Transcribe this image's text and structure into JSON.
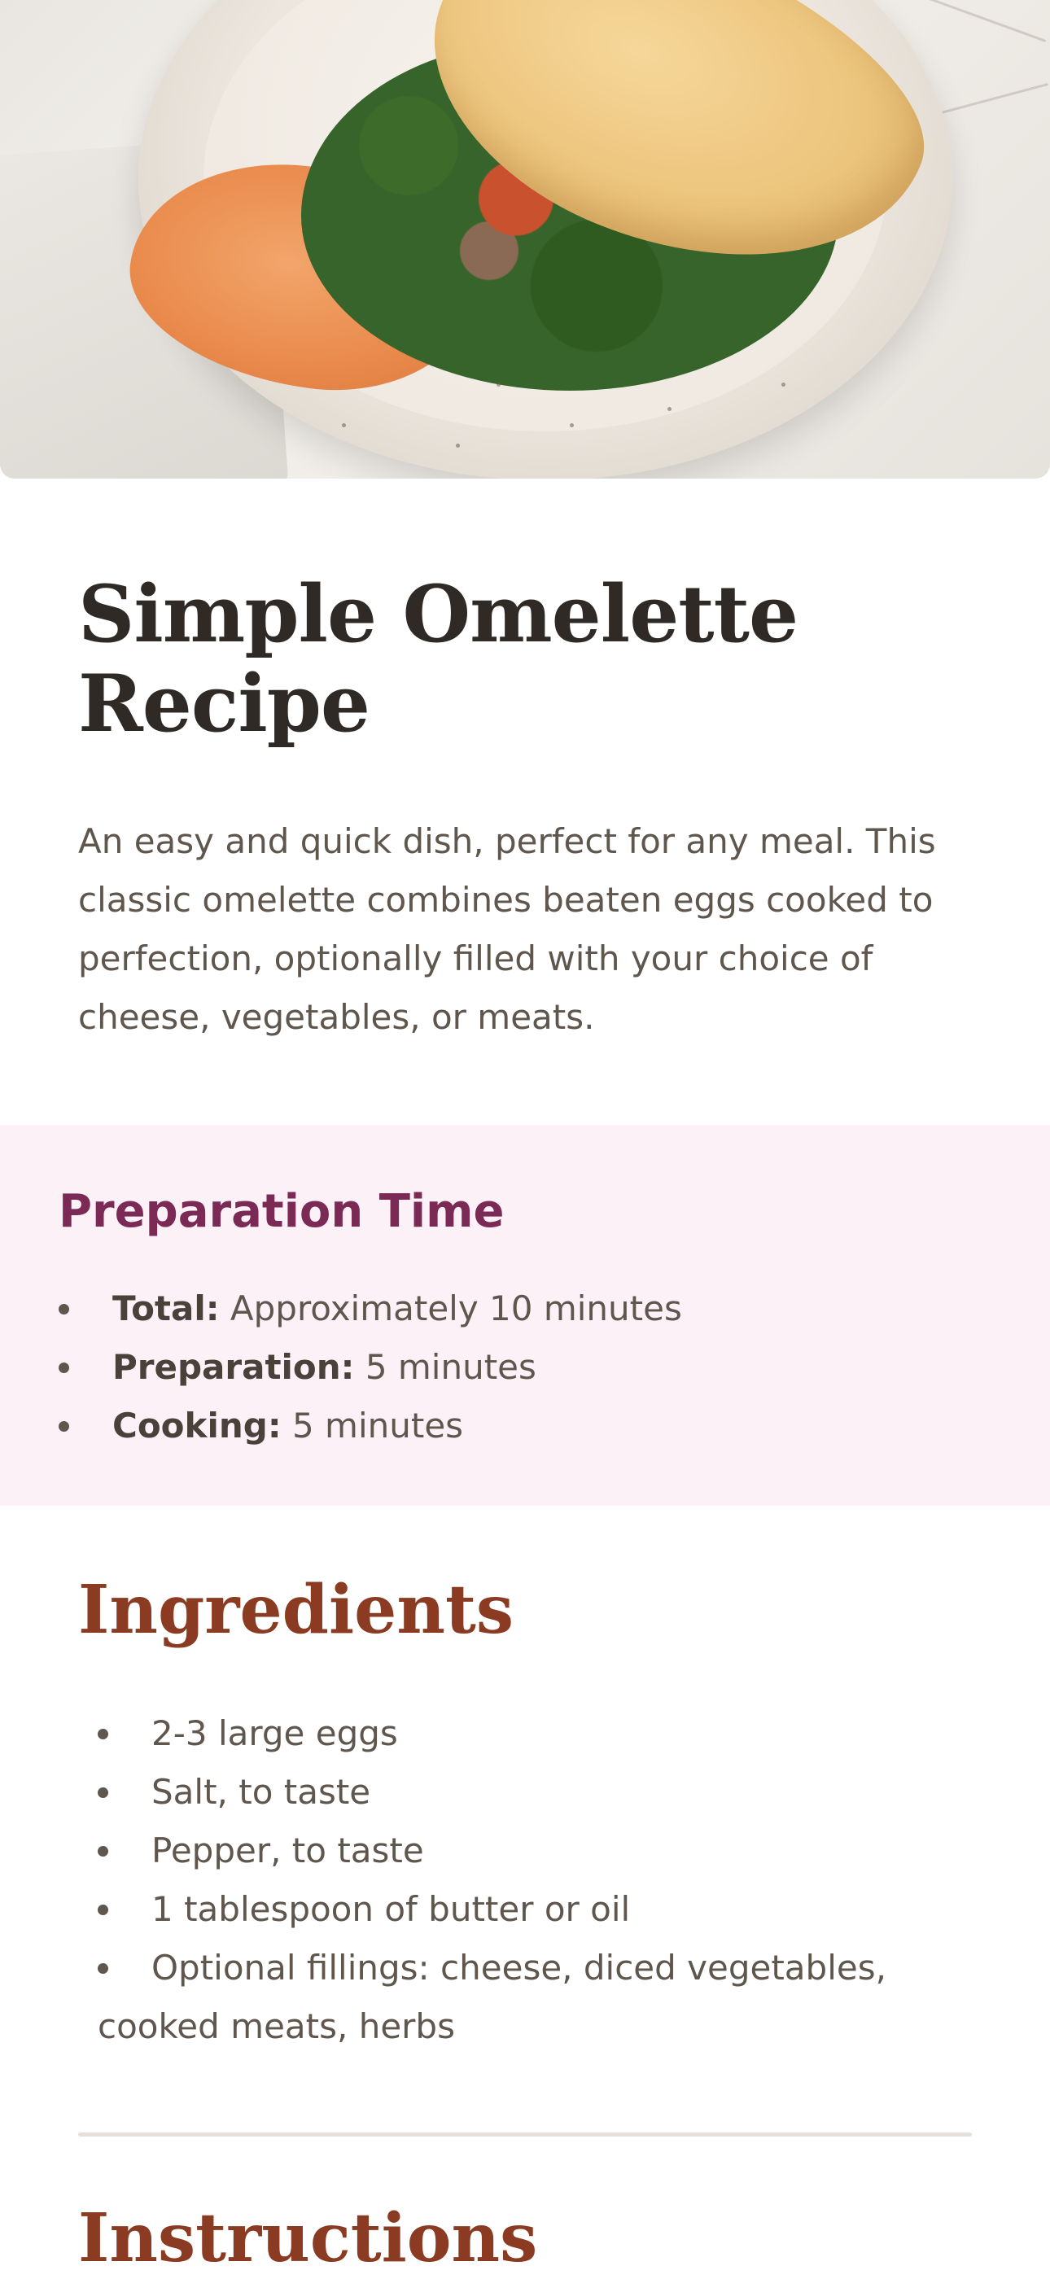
{
  "hero": {
    "image_alt": "Omelette with spinach, salmon and hummus on a ceramic plate"
  },
  "recipe": {
    "title": "Simple Omelette Recipe",
    "intro": "An easy and quick dish, perfect for any meal. This classic omelette combines beaten eggs cooked to perfection, optionally filled with your choice of cheese, vegetables, or meats."
  },
  "preparation": {
    "heading": "Preparation Time",
    "items": [
      {
        "label": "Total:",
        "value": " Approximately 10 minutes"
      },
      {
        "label": "Preparation:",
        "value": " 5 minutes"
      },
      {
        "label": "Cooking:",
        "value": " 5 minutes"
      }
    ]
  },
  "ingredients": {
    "heading": "Ingredients",
    "items": [
      "2-3 large eggs",
      "Salt, to taste",
      "Pepper, to taste",
      "1 tablespoon of butter or oil",
      "Optional fillings: cheese, diced vegetables, cooked meats, herbs"
    ]
  },
  "instructions": {
    "heading": "Instructions"
  },
  "colors": {
    "title": "#2f2a26",
    "body": "#5f564d",
    "prep_bg": "#fdf1f8",
    "prep_heading": "#7a2a55",
    "section_heading": "#8a3b22",
    "divider": "#e6e0dc"
  }
}
